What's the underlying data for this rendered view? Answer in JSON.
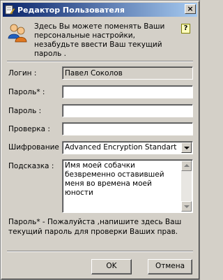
{
  "window": {
    "title": "Редактор Пользователя",
    "close_label": "×"
  },
  "intro": {
    "text": "Здесь Вы можете поменять Ваши персональные настройки, незабудьте ввести Ваш текущий пароль .",
    "help_label": "?"
  },
  "form": {
    "login_label": "Логин :",
    "login_value": "Павел Соколов",
    "password_current_label": "Пароль* :",
    "password_current_value": "",
    "password_label": "Пароль :",
    "password_value": "",
    "confirm_label": "Проверка :",
    "confirm_value": "",
    "encryption_label": "Шифрование :",
    "encryption_value": "Advanced Encryption Standart",
    "hint_label": "Подсказка :",
    "hint_value": "Имя моей собачки безвременно оставившей меня во времена моей юности"
  },
  "footnote": "Пароль* - Пожалуйста ,напишите здесь Ваш текущий пароль для проверки Ваших прав.",
  "buttons": {
    "ok_label": "OK",
    "cancel_label": "Отмена"
  },
  "colors": {
    "title_start": "#0a246a",
    "title_end": "#a6caf0",
    "face": "#d4d0c8"
  },
  "icons": {
    "title": "user-edit-icon",
    "intro": "users-icon",
    "help": "help-icon"
  }
}
